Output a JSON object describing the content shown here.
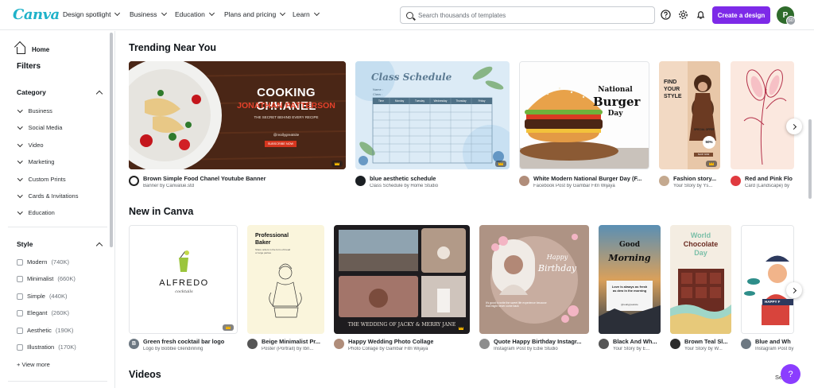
{
  "app": {
    "logo": "Canva"
  },
  "nav": {
    "items": [
      {
        "label": "Design spotlight"
      },
      {
        "label": "Business"
      },
      {
        "label": "Education"
      },
      {
        "label": "Plans and pricing"
      },
      {
        "label": "Learn"
      }
    ],
    "search_placeholder": "Search thousands of templates",
    "create_label": "Create a design",
    "avatar_initial": "P",
    "avatar_badge": "SD"
  },
  "sidebar": {
    "home_label": "Home",
    "filters_title": "Filters",
    "category_title": "Category",
    "categories": [
      "Business",
      "Social Media",
      "Video",
      "Marketing",
      "Custom Prints",
      "Cards & Invitations",
      "Education"
    ],
    "style_title": "Style",
    "styles": [
      {
        "name": "Modern",
        "count": "(740K)"
      },
      {
        "name": "Minimalist",
        "count": "(660K)"
      },
      {
        "name": "Simple",
        "count": "(440K)"
      },
      {
        "name": "Elegant",
        "count": "(260K)"
      },
      {
        "name": "Aesthetic",
        "count": "(190K)"
      },
      {
        "name": "Illustration",
        "count": "(170K)"
      }
    ],
    "view_more": "+ View more"
  },
  "trending": {
    "title": "Trending Near You",
    "cards": [
      {
        "title": "Brown Simple Food Chanel Youtube Banner",
        "subtitle": "Banner by Canvalue.std",
        "art_title": "COOKING CHHANEL",
        "art_sub": "JONATHAN PATTERSON",
        "art_tag": "THE SECRET BEHIND EVERY RECIPE",
        "art_handle": "@reallygreatsite",
        "art_btn": "SUBSCRIBE NOW"
      },
      {
        "title": "blue aesthetic schedule",
        "subtitle": "Class Schedule by Home Studio",
        "art_title": "Class Schedule",
        "art_name": "Name :",
        "art_class": "Class :",
        "art_cols": [
          "Time",
          "Monday",
          "Tuesday",
          "Wednesday",
          "Thursday",
          "Friday"
        ]
      },
      {
        "title": "White Modern National Burger Day (F...",
        "subtitle": "Facebook Post by Gambar Fitri Wijaya",
        "art_title1": "National",
        "art_title2": "Burger",
        "art_title3": "Day"
      },
      {
        "title": "Fashion story...",
        "subtitle": "Your Story by Ys...",
        "art_title1": "FIND",
        "art_title2": "YOUR",
        "art_title3": "STYLE",
        "art_offer": "SPECIAL OFFER",
        "art_pct": "50%",
        "art_btn": "SHOP NOW"
      },
      {
        "title": "Red and Pink Flo",
        "subtitle": "Card (Landscape) by"
      }
    ]
  },
  "new_in": {
    "title": "New in Canva",
    "cards": [
      {
        "title": "Green fresh cocktail bar logo",
        "subtitle": "Logo by Bobbie Glendinning",
        "icon_letter": "B",
        "art_title": "ALFREDO",
        "art_sub": "cocktails"
      },
      {
        "title": "Beige Minimalist Pr...",
        "subtitle": "Poster (Portrait) by Ibn...",
        "art_title1": "Professional",
        "art_title2": "Baker",
        "art_sub": "Share orders in the form of bread or large parties"
      },
      {
        "title": "Happy Wedding Photo Collage",
        "subtitle": "Photo Collage by Gambar Fitri Wijaya",
        "art_caption": "THE WEDDING OF JACKY & MERRY JANE"
      },
      {
        "title": "Quote Happy Birthday Instagr...",
        "subtitle": "Instagram Post by Edie Studio",
        "art_title1": "Happy",
        "art_title2": "Birthday",
        "art_sub": "It's good to write the sweet life experience because that might never come back"
      },
      {
        "title": "Black And Wh...",
        "subtitle": "Your Story by E...",
        "art_title1": "Good",
        "art_title2": "Morning",
        "art_quote": "Love is always as fresh as dew in the morning",
        "art_site": "@reallygreatsite"
      },
      {
        "title": "Brown Teal Sl...",
        "subtitle": "Your Story by W...",
        "art_title1": "World",
        "art_title2": "Chocolate",
        "art_title3": "Day"
      },
      {
        "title": "Blue and Wh",
        "subtitle": "Instagram Post by",
        "art_title": "HAPPY F"
      }
    ]
  },
  "videos": {
    "title": "Videos",
    "see_all": "Se"
  },
  "help_label": "?"
}
